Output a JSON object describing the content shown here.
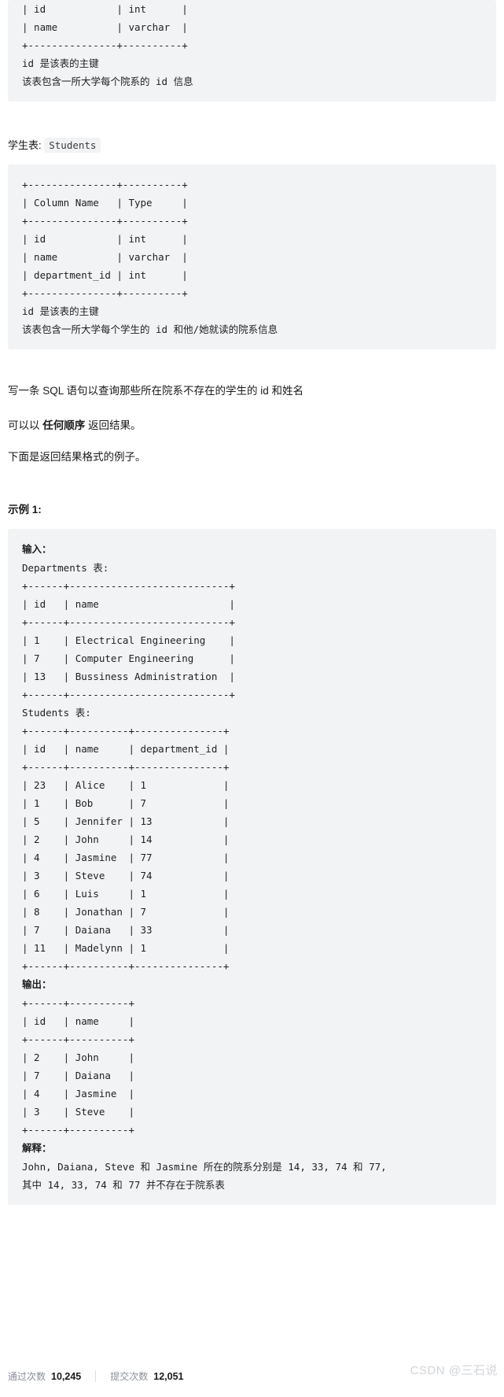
{
  "departments_schema_block": "| id            | int      |\n| name          | varchar  |\n+---------------+----------+\nid 是该表的主键\n该表包含一所大学每个院系的 id 信息",
  "students_table_label": {
    "prefix": "学生表:",
    "code": "Students"
  },
  "students_schema_block": "+---------------+----------+\n| Column Name   | Type     |\n+---------------+----------+\n| id            | int      |\n| name          | varchar  |\n| department_id | int      |\n+---------------+----------+\nid 是该表的主键\n该表包含一所大学每个学生的 id 和他/她就读的院系信息",
  "prose": {
    "line1": "写一条 SQL 语句以查询那些所在院系不存在的学生的 id 和姓名",
    "line2_before": "可以以 ",
    "line2_strong": "任何顺序",
    "line2_after": " 返回结果。",
    "line3": "下面是返回结果格式的例子。"
  },
  "example_heading": "示例 1:",
  "example_block": {
    "input_label": "输入：",
    "departments_caption": "Departments 表:",
    "departments_table": "+------+---------------------------+\n| id   | name                      |\n+------+---------------------------+\n| 1    | Electrical Engineering    |\n| 7    | Computer Engineering      |\n| 13   | Bussiness Administration  |\n+------+---------------------------+",
    "students_caption": "Students 表:",
    "students_table": "+------+----------+---------------+\n| id   | name     | department_id |\n+------+----------+---------------+\n| 23   | Alice    | 1             |\n| 1    | Bob      | 7             |\n| 5    | Jennifer | 13            |\n| 2    | John     | 14            |\n| 4    | Jasmine  | 77            |\n| 3    | Steve    | 74            |\n| 6    | Luis     | 1             |\n| 8    | Jonathan | 7             |\n| 7    | Daiana   | 33            |\n| 11   | Madelynn | 1             |\n+------+----------+---------------+",
    "output_label": "输出：",
    "output_table": "+------+----------+\n| id   | name     |\n+------+----------+\n| 2    | John     |\n| 7    | Daiana   |\n| 4    | Jasmine  |\n| 3    | Steve    |\n+------+----------+",
    "explain_label": "解释：",
    "explain_text": "John, Daiana, Steve 和 Jasmine 所在的院系分别是 14, 33, 74 和 77,\n其中 14, 33, 74 和 77 并不存在于院系表"
  },
  "footer": {
    "pass_label": "通过次数",
    "pass_value": "10,245",
    "submit_label": "提交次数",
    "submit_value": "12,051",
    "watermark": "CSDN @三石说"
  }
}
